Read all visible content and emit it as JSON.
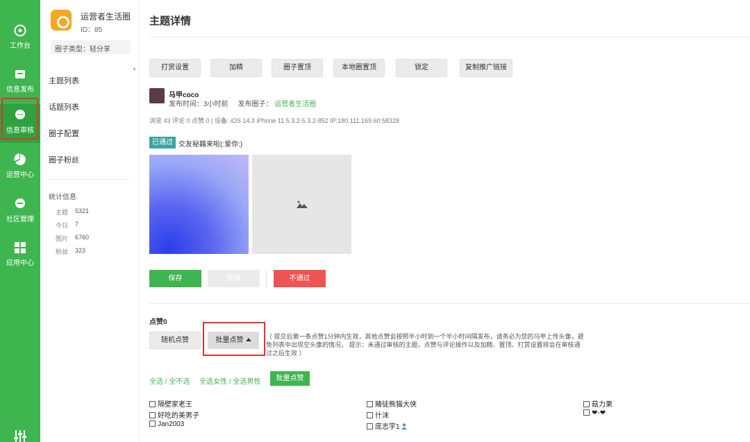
{
  "nav": {
    "items": [
      {
        "label": "工作台",
        "icon": "compass-icon"
      },
      {
        "label": "信息发布",
        "icon": "publish-icon"
      },
      {
        "label": "信息审核",
        "icon": "chat-bubble-icon"
      },
      {
        "label": "运营中心",
        "icon": "pie-chart-icon"
      },
      {
        "label": "社区管理",
        "icon": "community-icon"
      },
      {
        "label": "应用中心",
        "icon": "apps-grid-icon"
      }
    ],
    "accent": "#3fb550",
    "highlight": "#e0322d"
  },
  "sidebar": {
    "circle_name": "运营者生活圈",
    "circle_id": "ID：85",
    "circle_type": "圈子类型：轻分享",
    "menu": [
      "主题列表",
      "话题列表",
      "圈子配置",
      "圈子粉丝"
    ],
    "stats_title": "统计信息",
    "stats": [
      {
        "label": "主题",
        "value": "5321"
      },
      {
        "label": "今日",
        "value": "7"
      },
      {
        "label": "图片",
        "value": "6760"
      },
      {
        "label": "粉丝",
        "value": "323"
      }
    ]
  },
  "main": {
    "title": "主题详情",
    "toolbar": [
      "打赏设置",
      "加精",
      "圈子置顶",
      "本地圈置顶",
      "锁定",
      "复制推广链接"
    ],
    "post": {
      "author": "马甲coco",
      "time": "发布时间：3小时前",
      "circle_label": "发布圈子：",
      "circle_link": "运营者生活圈",
      "info": "浏览 43   评论 0   点赞 0   | 设备: iOS 14.3 iPhone 11 5.3.2-5.3.2-852 IP:180.111.169.60:58328",
      "status": "已通过",
      "text": "交友秘籍来啦(:爱你:)"
    },
    "actions": {
      "save": "保存",
      "cancel": "取消",
      "reject": "不通过"
    },
    "likes": {
      "title": "点赞0",
      "random_btn": "随机点赞",
      "batch_btn": "批量点赞",
      "note": "（ 提交后第一条点赞1分钟内生效，其他点赞会按照半小时到一个半小时间隔发布，请务必为您的马甲上传头像，避免列表中出现空头像的情况， 提示：未通过审核的主题，点赞与评论操作以及加精、置顶、打赏设置将会在审核通过之后生效 ）",
      "select_all": "全选 / 全不选",
      "select_gender": "全选女性 / 全选男性",
      "batch_btn2": "批量点赞",
      "users": [
        "隔壁家老王",
        "好吃的美男子",
        "Jan2003",
        "赌徒熊猫大侠",
        "什沫",
        "庞志宇1",
        "菇力果",
        "❤-❤"
      ]
    }
  }
}
